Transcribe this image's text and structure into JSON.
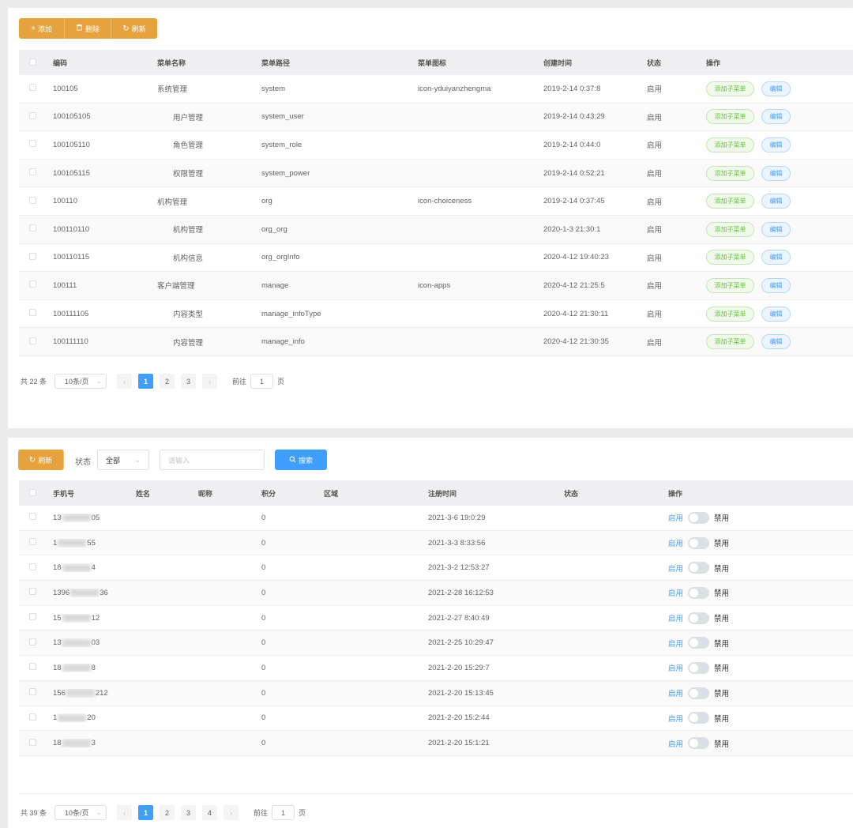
{
  "menu_panel": {
    "toolbar": {
      "add_label": "添加",
      "delete_label": "删除",
      "refresh_label": "刷新"
    },
    "columns": [
      "编码",
      "菜单名称",
      "菜单路径",
      "菜单图标",
      "创建时间",
      "状态",
      "操作"
    ],
    "rows": [
      {
        "code": "100105",
        "name": "系统管理",
        "child": false,
        "path": "system",
        "icon": "icon-yduiyanzhengma",
        "created": "2019-2-14 0:37:8",
        "status": "启用"
      },
      {
        "code": "100105105",
        "name": "用户管理",
        "child": true,
        "path": "system_user",
        "icon": "",
        "created": "2019-2-14 0:43:29",
        "status": "启用"
      },
      {
        "code": "100105110",
        "name": "角色管理",
        "child": true,
        "path": "system_role",
        "icon": "",
        "created": "2019-2-14 0:44:0",
        "status": "启用"
      },
      {
        "code": "100105115",
        "name": "权限管理",
        "child": true,
        "path": "system_power",
        "icon": "",
        "created": "2019-2-14 0:52:21",
        "status": "启用"
      },
      {
        "code": "100110",
        "name": "机构管理",
        "child": false,
        "path": "org",
        "icon": "icon-choiceness",
        "created": "2019-2-14 0:37:45",
        "status": "启用"
      },
      {
        "code": "100110110",
        "name": "机构管理",
        "child": true,
        "path": "org_org",
        "icon": "",
        "created": "2020-1-3 21:30:1",
        "status": "启用"
      },
      {
        "code": "100110115",
        "name": "机构信息",
        "child": true,
        "path": "org_orgInfo",
        "icon": "",
        "created": "2020-4-12 19:40:23",
        "status": "启用"
      },
      {
        "code": "100111",
        "name": "客户端管理",
        "child": false,
        "path": "manage",
        "icon": "icon-apps",
        "created": "2020-4-12 21:25:5",
        "status": "启用"
      },
      {
        "code": "100111105",
        "name": "内容类型",
        "child": true,
        "path": "manage_infoType",
        "icon": "",
        "created": "2020-4-12 21:30:11",
        "status": "启用"
      },
      {
        "code": "100111110",
        "name": "内容管理",
        "child": true,
        "path": "manage_info",
        "icon": "",
        "created": "2020-4-12 21:30:35",
        "status": "启用"
      }
    ],
    "row_actions": {
      "add_child": "添加子菜单",
      "edit": "编辑"
    },
    "pagination": {
      "total": "共 22 条",
      "page_size": "10条/页",
      "pages": [
        "1",
        "2",
        "3"
      ],
      "prev": "‹",
      "next": "›",
      "goto_prefix": "前往",
      "goto_value": "1",
      "goto_suffix": "页"
    }
  },
  "user_panel": {
    "toolbar": {
      "refresh_label": "刷新",
      "status_label": "状态",
      "status_value": "全部",
      "search_placeholder": "请输入",
      "search_label": "搜索"
    },
    "columns": [
      "手机号",
      "姓名",
      "昵称",
      "积分",
      "区域",
      "注册时间",
      "状态",
      "操作"
    ],
    "rows": [
      {
        "phone_start": "13",
        "phone_end": "05",
        "points": "0",
        "registered": "2021-3-6 19:0:29"
      },
      {
        "phone_start": "1",
        "phone_end": "55",
        "points": "0",
        "registered": "2021-3-3 8:33:56"
      },
      {
        "phone_start": "18",
        "phone_end": "4",
        "points": "0",
        "registered": "2021-3-2 12:53:27"
      },
      {
        "phone_start": "1396",
        "phone_end": "36",
        "points": "0",
        "registered": "2021-2-28 16:12:53"
      },
      {
        "phone_start": "15",
        "phone_end": "12",
        "points": "0",
        "registered": "2021-2-27 8:40:49"
      },
      {
        "phone_start": "13",
        "phone_end": "03",
        "points": "0",
        "registered": "2021-2-25 10:29:47"
      },
      {
        "phone_start": "18",
        "phone_end": "8",
        "points": "0",
        "registered": "2021-2-20 15:29:7"
      },
      {
        "phone_start": "156",
        "phone_end": "212",
        "points": "0",
        "registered": "2021-2-20 15:13:45"
      },
      {
        "phone_start": "1",
        "phone_end": "20",
        "points": "0",
        "registered": "2021-2-20 15:2:44"
      },
      {
        "phone_start": "18",
        "phone_end": "3",
        "points": "0",
        "registered": "2021-2-20 15:1:21"
      }
    ],
    "row_actions": {
      "enable": "启用",
      "disable": "禁用"
    },
    "pagination": {
      "total": "共 39 条",
      "page_size": "10条/页",
      "pages": [
        "1",
        "2",
        "3",
        "4"
      ],
      "prev": "‹",
      "next": "›",
      "goto_prefix": "前往",
      "goto_value": "1",
      "goto_suffix": "页"
    }
  },
  "colors": {
    "orange": "#e6a23c",
    "blue": "#409eff",
    "green": "#67c23a"
  }
}
